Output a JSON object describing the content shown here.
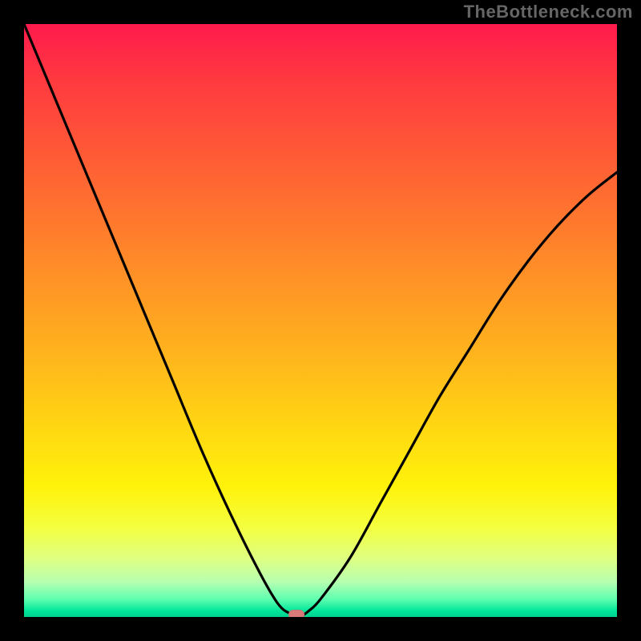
{
  "watermark": "TheBottleneck.com",
  "chart_data": {
    "type": "line",
    "title": "",
    "xlabel": "",
    "ylabel": "",
    "xlim": [
      0,
      100
    ],
    "ylim": [
      0,
      100
    ],
    "grid": false,
    "series": [
      {
        "name": "bottleneck-curve",
        "x": [
          0,
          5,
          10,
          15,
          20,
          25,
          30,
          35,
          40,
          43,
          45,
          46,
          47,
          48,
          50,
          55,
          60,
          65,
          70,
          75,
          80,
          85,
          90,
          95,
          100
        ],
        "y": [
          100,
          88,
          76,
          64,
          52,
          40,
          28,
          17,
          7,
          2,
          0.5,
          0,
          0.3,
          1,
          3,
          10,
          19,
          28,
          37,
          45,
          53,
          60,
          66,
          71,
          75
        ]
      }
    ],
    "marker": {
      "x": 46,
      "y": 0
    },
    "background_gradient": {
      "stops": [
        {
          "pos": 0,
          "color": "#ff1a4d"
        },
        {
          "pos": 50,
          "color": "#ffb400"
        },
        {
          "pos": 80,
          "color": "#fff20a"
        },
        {
          "pos": 95,
          "color": "#a0ffb0"
        },
        {
          "pos": 100,
          "color": "#00d090"
        }
      ]
    }
  }
}
